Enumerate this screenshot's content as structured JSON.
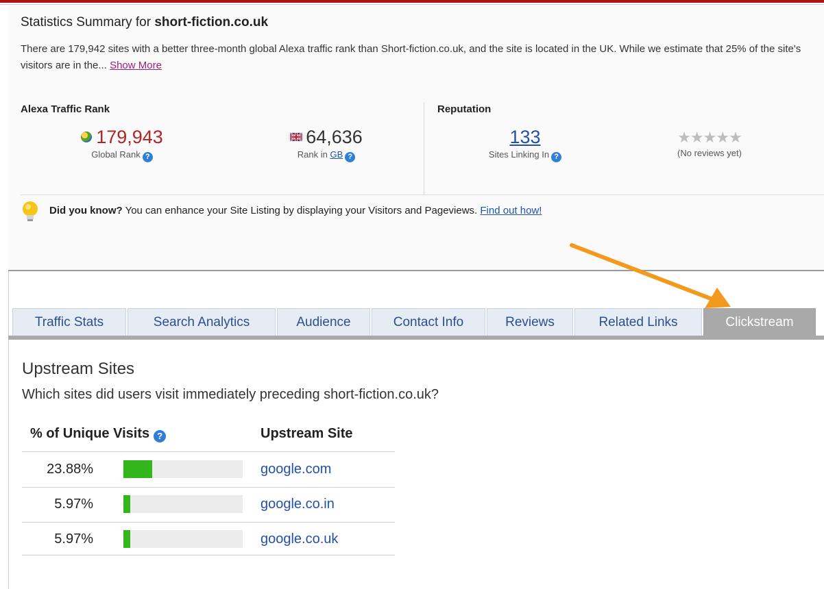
{
  "summary": {
    "title_prefix": "Statistics Summary for ",
    "title_domain": "short-fiction.co.uk",
    "description": "There are 179,942 sites with a better three-month global Alexa traffic rank than Short-fiction.co.uk, and the site is located in the UK. While we estimate that 25% of the site's visitors are in the...",
    "show_more": "Show More"
  },
  "traffic_rank": {
    "heading": "Alexa Traffic Rank",
    "global_value": "179,943",
    "global_label": "Global Rank",
    "local_value": "64,636",
    "local_label_prefix": "Rank in ",
    "local_country": "GB"
  },
  "reputation": {
    "heading": "Reputation",
    "links_value": "133",
    "links_label": "Sites Linking In",
    "stars": "★★★★★",
    "reviews_label": "(No reviews yet)"
  },
  "tip": {
    "lead": "Did you know?",
    "text": " You can enhance your Site Listing by displaying your Visitors and Pageviews. ",
    "link": "Find out how!"
  },
  "tabs": [
    {
      "label": "Traffic Stats"
    },
    {
      "label": "Search Analytics"
    },
    {
      "label": "Audience"
    },
    {
      "label": "Contact Info"
    },
    {
      "label": "Reviews"
    },
    {
      "label": "Related Links"
    },
    {
      "label": "Clickstream",
      "active": true
    }
  ],
  "upstream": {
    "title": "Upstream Sites",
    "subtitle": "Which sites did users visit immediately preceding short-fiction.co.uk?",
    "col_pct": "% of Unique Visits",
    "col_site": "Upstream Site",
    "rows": [
      {
        "pct": "23.88%",
        "share": 23.88,
        "site": "google.com"
      },
      {
        "pct": "5.97%",
        "share": 5.97,
        "site": "google.co.in"
      },
      {
        "pct": "5.97%",
        "share": 5.97,
        "site": "google.co.uk"
      }
    ]
  },
  "colors": {
    "global_rank": "#b02525",
    "bar_fill": "#33b51c",
    "link": "#2451a8",
    "arrow": "#f29a1d"
  },
  "icons": [
    "globe-icon",
    "uk-flag-icon",
    "help-icon",
    "lightbulb-icon",
    "star-icon",
    "arrow-annotation"
  ]
}
